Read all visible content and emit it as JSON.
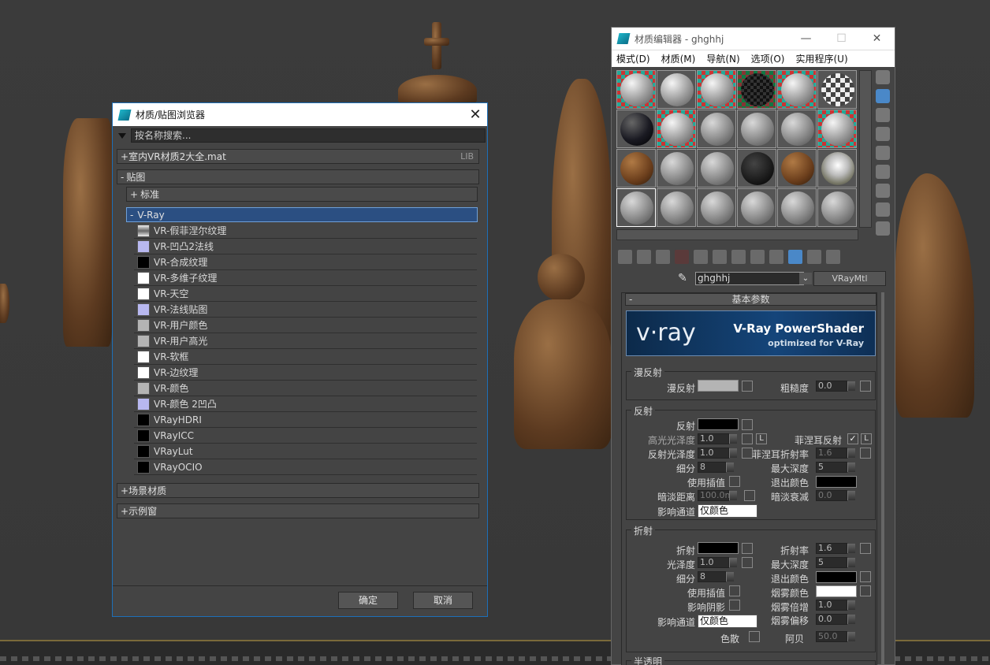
{
  "browser": {
    "title": "材质/贴图浏览器",
    "close": "✕",
    "search_placeholder": "按名称搜索...",
    "groups": [
      {
        "sign": "+",
        "label": "室内VR材质2大全.mat",
        "tag": "LIB"
      },
      {
        "sign": "-",
        "label": "贴图"
      },
      {
        "sign": "+",
        "label": "标准"
      },
      {
        "sign": "-",
        "label": "V-Ray"
      }
    ],
    "vray_maps": [
      {
        "label": "VR-假菲涅尔纹理",
        "color": "#8c8c8c"
      },
      {
        "label": "VR-凹凸2法线",
        "color": "#b8b8f0"
      },
      {
        "label": "VR-合成纹理",
        "color": "#000000"
      },
      {
        "label": "VR-多维子纹理",
        "color": "#ffffff"
      },
      {
        "label": "VR-天空",
        "color": "#ffffff"
      },
      {
        "label": "VR-法线贴图",
        "color": "#b8b8f0"
      },
      {
        "label": "VR-用户颜色",
        "color": "#b4b4b4"
      },
      {
        "label": "VR-用户高光",
        "color": "#b4b4b4"
      },
      {
        "label": "VR-软框",
        "color": "#ffffff"
      },
      {
        "label": "VR-边纹理",
        "color": "#ffffff"
      },
      {
        "label": "VR-颜色",
        "color": "#b4b4b4"
      },
      {
        "label": "VR-颜色 2凹凸",
        "color": "#b8b8f0"
      },
      {
        "label": "VRayHDRI",
        "color": "#000000"
      },
      {
        "label": "VRayICC",
        "color": "#000000"
      },
      {
        "label": "VRayLut",
        "color": "#000000"
      },
      {
        "label": "VRayOCIO",
        "color": "#000000"
      }
    ],
    "bottom_groups": [
      {
        "sign": "+",
        "label": "场景材质"
      },
      {
        "sign": "+",
        "label": "示例窗"
      }
    ],
    "ok": "确定",
    "cancel": "取消"
  },
  "editor": {
    "title": "材质编辑器 - ghghhj",
    "menu": [
      "模式(D)",
      "材质(M)",
      "导航(N)",
      "选项(O)",
      "实用程序(U)"
    ],
    "material_name": "ghghhj",
    "material_type": "VRayMtl",
    "rollout_title": "基本参数",
    "banner_title": "V-Ray PowerShader",
    "banner_sub": "optimized for V-Ray",
    "banner_logo": "v·ray",
    "diffuse": {
      "group": "漫反射",
      "diffuse": "漫反射",
      "roughness": "粗糙度",
      "roughness_val": "0.0"
    },
    "reflection": {
      "group": "反射",
      "reflect": "反射",
      "hilight_gloss": "高光光泽度",
      "hilight_gloss_val": "1.0",
      "L": "L",
      "fresnel": "菲涅耳反射",
      "refl_gloss": "反射光泽度",
      "refl_gloss_val": "1.0",
      "fresnel_ior": "菲涅耳折射率",
      "fresnel_ior_val": "1.6",
      "subdivs": "细分",
      "subdivs_val": "8",
      "max_depth": "最大深度",
      "max_depth_val": "5",
      "use_interp": "使用插值",
      "exit_color": "退出颜色",
      "dim_dist": "暗淡距离",
      "dim_dist_val": "100.0m",
      "dim_falloff": "暗淡衰减",
      "dim_falloff_val": "0.0",
      "affect_ch": "影响通道",
      "affect_ch_val": "仅颜色"
    },
    "refraction": {
      "group": "折射",
      "refract": "折射",
      "ior": "折射率",
      "ior_val": "1.6",
      "gloss": "光泽度",
      "gloss_val": "1.0",
      "max_depth": "最大深度",
      "max_depth_val": "5",
      "subdivs": "细分",
      "subdivs_val": "8",
      "exit_color": "退出颜色",
      "use_interp": "使用插值",
      "fog_color": "烟雾颜色",
      "affect_shadows": "影响阴影",
      "fog_mult": "烟雾倍增",
      "fog_mult_val": "1.0",
      "affect_ch": "影响通道",
      "affect_ch_val": "仅颜色",
      "fog_bias": "烟雾偏移",
      "fog_bias_val": "0.0",
      "dispersion": "色散",
      "abbe": "阿贝",
      "abbe_val": "50.0"
    },
    "translucency": "半透明"
  }
}
